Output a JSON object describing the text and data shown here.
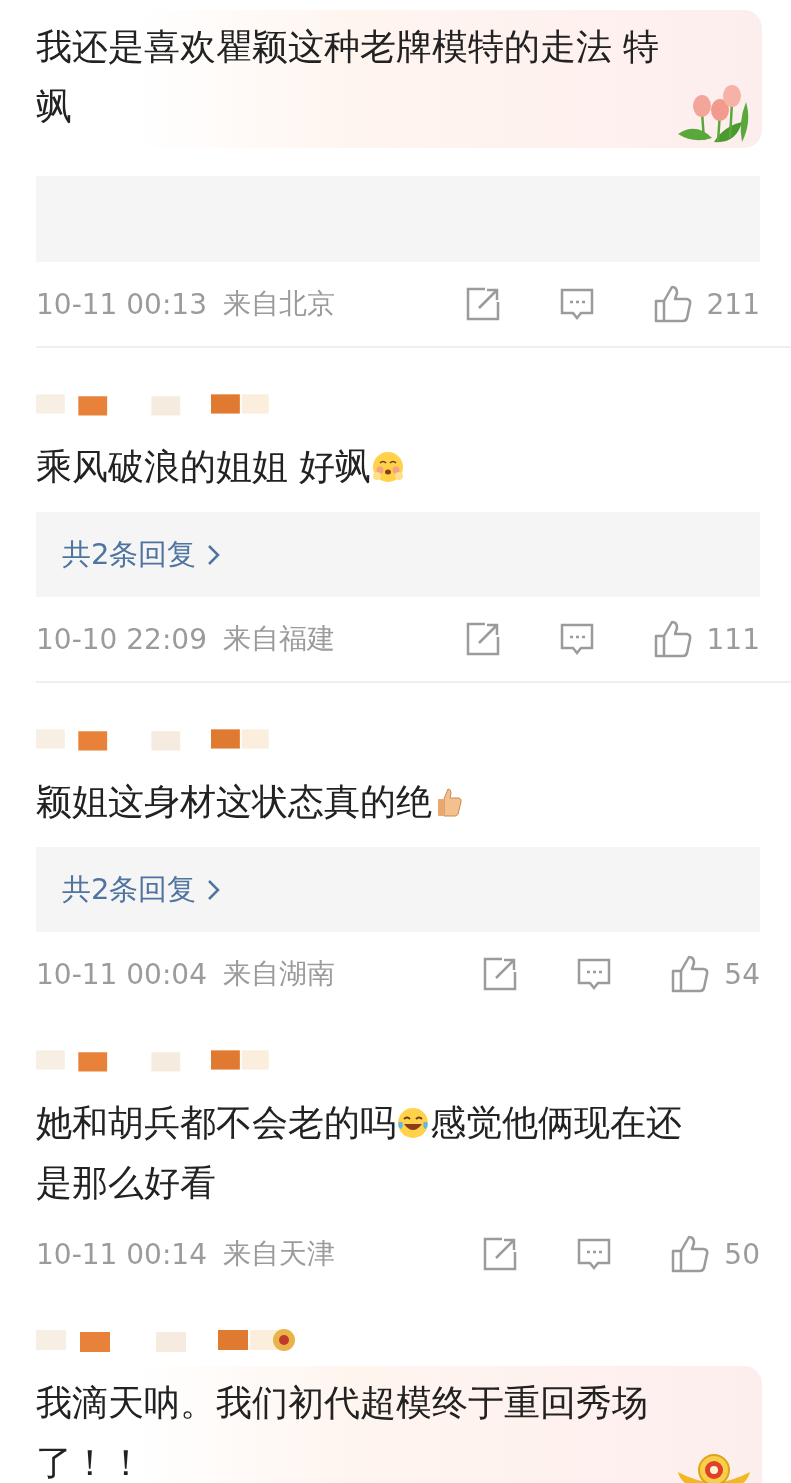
{
  "comments": [
    {
      "user_blurred": false,
      "decoration": {
        "kind": "tulips"
      },
      "lines": [
        [
          {
            "kind": "text",
            "text": "我还是喜欢瞿颖这种老牌模特的走法 特"
          }
        ],
        [
          {
            "kind": "text",
            "text": "飒"
          }
        ]
      ],
      "panel": {
        "kind": "blank"
      },
      "time": "10-11 00:13",
      "location": "来自北京",
      "likes": "211",
      "divider": true
    },
    {
      "user_blurred": true,
      "lines": [
        [
          {
            "kind": "text",
            "text": "乘风破浪的姐姐 好飒"
          },
          {
            "kind": "blush_emoji"
          }
        ]
      ],
      "panel": {
        "kind": "replies",
        "text": "共2条回复"
      },
      "time": "10-10 22:09",
      "location": "来自福建",
      "likes": "111",
      "divider": true
    },
    {
      "user_blurred": true,
      "lines": [
        [
          {
            "kind": "text",
            "text": "颖姐这身材这状态真的绝"
          },
          {
            "kind": "thumbs_up_emoji"
          }
        ]
      ],
      "panel": {
        "kind": "replies",
        "text": "共2条回复"
      },
      "time": "10-11 00:04",
      "location": "来自湖南",
      "likes": "54",
      "divider": false
    },
    {
      "user_blurred": true,
      "lines": [
        [
          {
            "kind": "text",
            "text": "她和胡兵都不会老的吗"
          },
          {
            "kind": "laugh_cry_emoji"
          },
          {
            "kind": "text",
            "text": "感觉他俩现在还"
          }
        ],
        [
          {
            "kind": "text",
            "text": "是那么好看"
          }
        ]
      ],
      "time": "10-11 00:14",
      "location": "来自天津",
      "likes": "50",
      "divider": false
    },
    {
      "user_blurred": true,
      "badge": true,
      "decoration": {
        "kind": "ingot"
      },
      "lines": [
        [
          {
            "kind": "text",
            "text": "我滴天呐。我们初代超模终于重回秀场"
          }
        ],
        [
          {
            "kind": "text",
            "text": "了！！"
          }
        ]
      ]
    }
  ]
}
